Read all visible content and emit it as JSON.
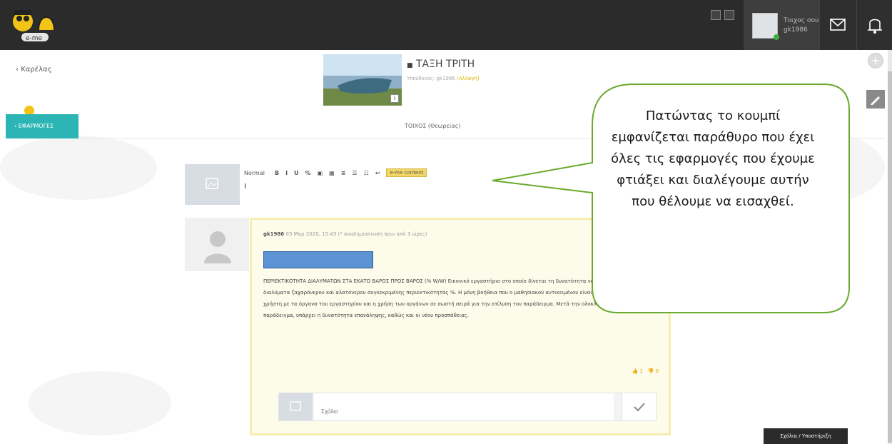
{
  "header": {
    "logo_text": "e-me",
    "user_line1": "Τοιχος σου",
    "user_line2": "gk1986"
  },
  "nav": {
    "back_label": "Καρέλας"
  },
  "group": {
    "title": "ΤΑΞΗ ΤΡΙΤΗ",
    "subtitle_prefix": "Υπεύθυνος: gk1986",
    "subtitle_link": "(Αλλαγή)",
    "image_info": "i"
  },
  "tabs": {
    "apps": "ΕΦΑΡΜΟΓΕΣ",
    "wall": "ΤΟΙΧΟΣ (Θεωρείας)"
  },
  "editor": {
    "format_label": "Normal",
    "tools": [
      "B",
      "I",
      "U",
      "%",
      "▣",
      "▦",
      "≡",
      "☰",
      "☷",
      "↩"
    ],
    "eme_button": "e-me content",
    "input_value": "I"
  },
  "post": {
    "author": "gk1986",
    "meta": "03 Μαρ 2020, 15:43 (* αναδημοσίευση πριν από 3 ώρες)",
    "text": "ΠΕΡΙΕΚΤΙΚΟΤΗΤΑ ΔΙΑΛΥΜΑΤΩΝ ΣΤΑ ΕΚΑΤΟ ΒΑΡΟΣ ΠΡΟΣ ΒΑΡΟΣ (% W/W) Εικονικό εργαστήριο στο οποίο δίνεται τη δυνατότητα να παρασκευάσει διαλύματα ζαχαρόνερου και αλατόνερου συγκεκριμένης περιεκτικότητας %. Η μόνη βοήθεια που ο μαθησιακού αντικειμένου είναι ο γνωσμός του χρήστη με τα όργανα του εργαστηρίου και η χρήση των οργάνων σε σωστή σειρά για την επίλυση του παράδειγμα. Μετά την ολοκλήρωση του παράδειγμα, υπάρχει η δυνατότητα επανάληψης, καθώς και οι νέου προσπάθειας.",
    "likes": "1",
    "dislikes": "0"
  },
  "comment": {
    "placeholder": "Σχόλιο"
  },
  "help_button": "Σχόλια / Υποστήριξη",
  "callout": {
    "text": "Πατώντας το κουμπί εμφανίζεται παράθυρο που έχει όλες τις εφαρμογές που έχουμε φτιάξει και διαλέγουμε αυτήν που θέλουμε να εισαχθεί.",
    "border_color": "#6aaa2e"
  },
  "colors": {
    "topbar": "#2b2b2b",
    "accent_teal": "#2db4b4",
    "accent_yellow": "#f2c418",
    "highlight_blue": "#5b93d5"
  }
}
